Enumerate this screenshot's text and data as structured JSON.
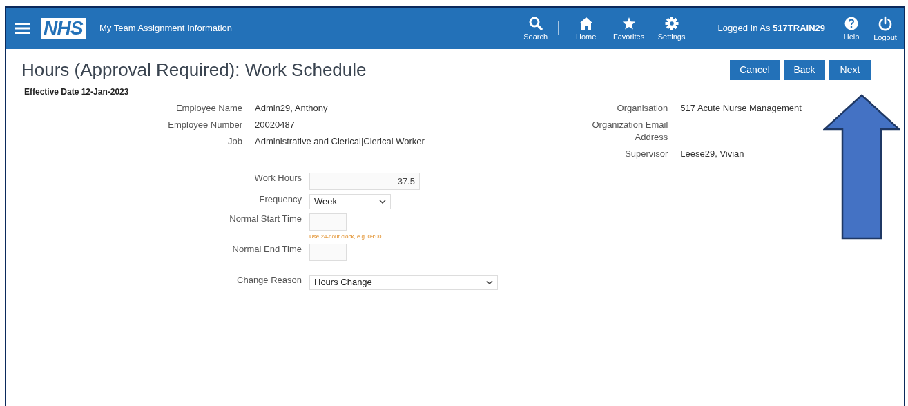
{
  "header": {
    "logo": "NHS",
    "title": "My Team Assignment Information",
    "nav": [
      {
        "kind": "search",
        "label": "Search"
      },
      {
        "kind": "home",
        "label": "Home"
      },
      {
        "kind": "favorites",
        "label": "Favorites"
      },
      {
        "kind": "settings",
        "label": "Settings"
      }
    ],
    "logged_in": "Logged In As **517TRAIN29**",
    "utility": [
      {
        "kind": "help",
        "label": "Help"
      },
      {
        "kind": "logout",
        "label": "Logout"
      }
    ]
  },
  "page": {
    "title": "Hours (Approval Required): Work Schedule",
    "buttons": [
      "Cancel",
      "Back",
      "Next"
    ],
    "effective_date": "Effective Date 12-Jan-2023"
  },
  "details_left": [
    {
      "label": "Employee Name",
      "value": "Admin29, Anthony"
    },
    {
      "label": "Employee Number",
      "value": "20020487"
    },
    {
      "label": "Job",
      "value": "Administrative and Clerical|Clerical Worker"
    }
  ],
  "details_right": [
    {
      "label": "Organisation",
      "value": "517 Acute Nurse Management"
    },
    {
      "label": "Organization Email Address"
    },
    {
      "label": "Supervisor",
      "value": "Leese29, Vivian"
    }
  ],
  "form": [
    {
      "kind": "text",
      "label": "Work Hours",
      "value": "37.5"
    },
    {
      "kind": "select",
      "label": "Frequency",
      "value": "Week"
    },
    {
      "kind": "time",
      "label": "Normal Start Time",
      "hint": "Use 24-hour clock, e.g. 09:00"
    },
    {
      "kind": "time",
      "label": "Normal End Time"
    },
    {
      "kind": "wide-select",
      "label": "Change Reason",
      "value": "Hours Change"
    }
  ],
  "annotation": {
    "kind": "up-arrow"
  }
}
